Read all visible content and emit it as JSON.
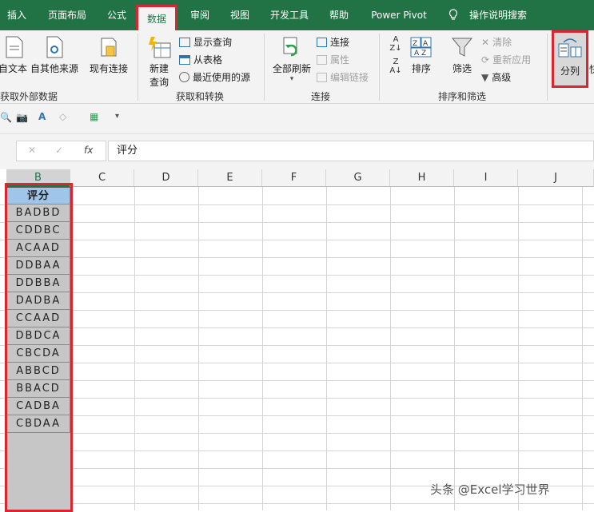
{
  "tabs": [
    "插入",
    "页面布局",
    "公式",
    "数据",
    "审阅",
    "视图",
    "开发工具",
    "帮助",
    "Power Pivot",
    "操作说明搜索"
  ],
  "active_tab": "数据",
  "ribbon": {
    "get_external": {
      "from_text": "自文本",
      "other_sources": "自其他来源",
      "existing": "现有连接",
      "label": "获取外部数据"
    },
    "get_transform": {
      "new_query_1": "新建",
      "new_query_2": "查询",
      "show_queries": "显示查询",
      "from_table": "从表格",
      "recent_sources": "最近使用的源",
      "label": "获取和转换"
    },
    "connections": {
      "refresh_all": "全部刷新",
      "connections": "连接",
      "properties": "属性",
      "edit_links": "编辑链接",
      "label": "连接"
    },
    "sort_filter": {
      "sort": "排序",
      "filter": "筛选",
      "clear": "清除",
      "reapply": "重新应用",
      "advanced": "高级",
      "label": "排序和筛选"
    },
    "split": {
      "label": "分列",
      "next": "快"
    }
  },
  "formula_bar": {
    "cancel": "✕",
    "enter": "✓",
    "fx": "fx",
    "value": "评分"
  },
  "columns": [
    "B",
    "C",
    "D",
    "E",
    "F",
    "G",
    "H",
    "I",
    "J"
  ],
  "sheet": {
    "header": "评分",
    "rows": [
      "BADBD",
      "CDDBC",
      "ACAAD",
      "DDBAA",
      "DDBBA",
      "DADBA",
      "CCAAD",
      "DBDCA",
      "CBCDA",
      "ABBCD",
      "BBACD",
      "CADBA",
      "CBDAA"
    ]
  },
  "watermark": "头条 @Excel学习世界",
  "colors": {
    "accent": "#217346",
    "highlight": "#d9262f",
    "header_fill": "#9fc5e8"
  }
}
